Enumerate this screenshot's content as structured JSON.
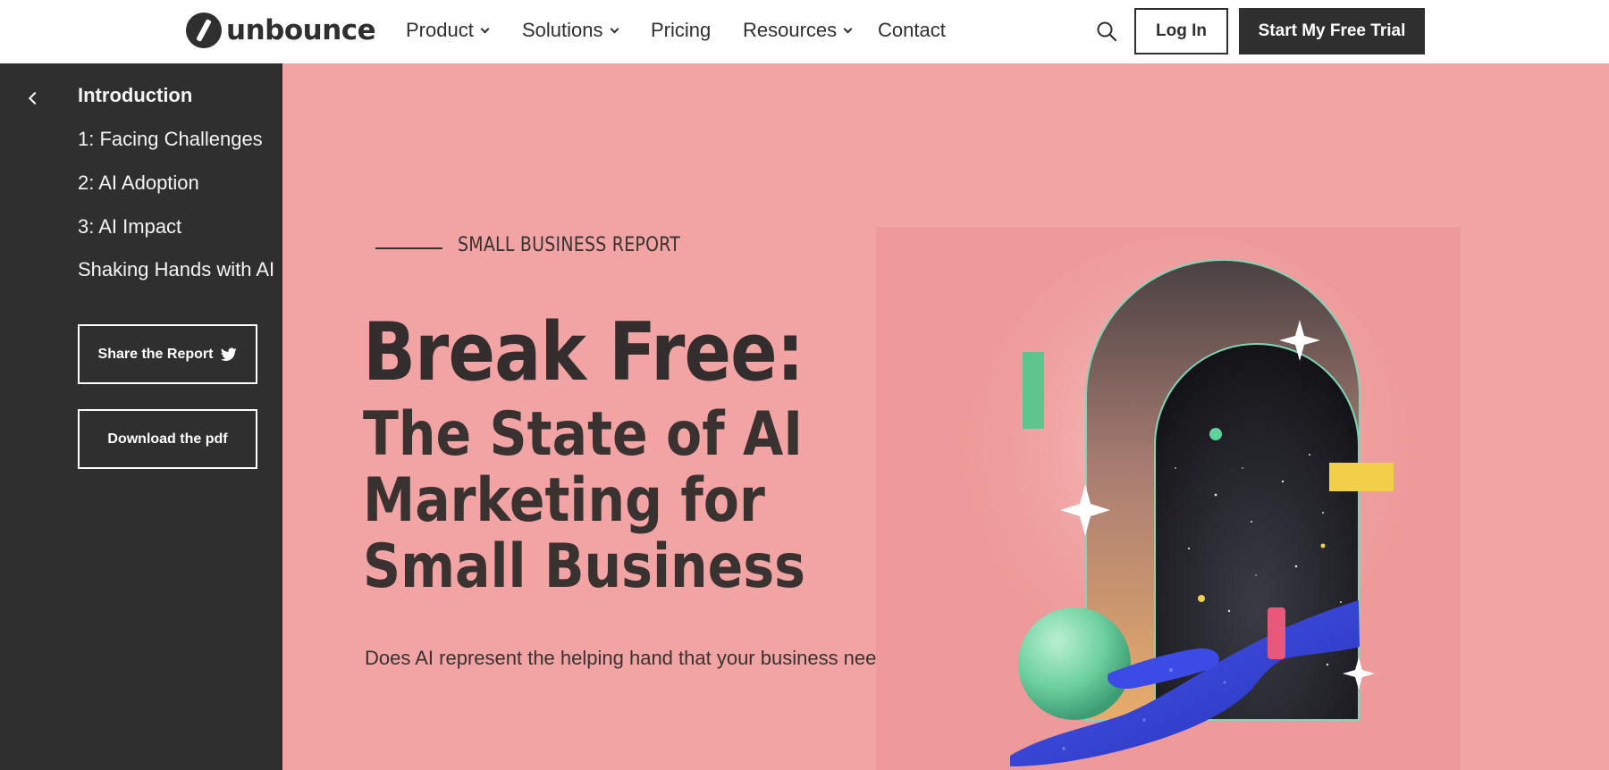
{
  "brand": {
    "name": "unbounce",
    "logo_icon": "unbounce-logo-icon"
  },
  "nav": {
    "items": [
      {
        "label": "Product",
        "dropdown": true
      },
      {
        "label": "Solutions",
        "dropdown": true
      },
      {
        "label": "Pricing",
        "dropdown": false
      },
      {
        "label": "Resources",
        "dropdown": true
      },
      {
        "label": "Contact",
        "dropdown": false
      }
    ],
    "search_icon": "search-icon",
    "login_label": "Log In",
    "trial_label": "Start My Free Trial"
  },
  "sidebar": {
    "back_icon": "chevron-left-icon",
    "items": [
      {
        "label": "Introduction",
        "active": true
      },
      {
        "label": "1: Facing Challenges"
      },
      {
        "label": "2: AI Adoption"
      },
      {
        "label": "3: AI Impact"
      },
      {
        "label": "Shaking Hands with AI"
      }
    ],
    "share_label": "Share the Report",
    "share_icon": "twitter-icon",
    "download_label": "Download the pdf"
  },
  "hero": {
    "eyebrow": "SMALL BUSINESS REPORT",
    "title": "Break Free:",
    "subtitle": "The State of AI Marketing for Small Business",
    "lede": "Does AI represent the helping hand that your business needs?"
  },
  "colors": {
    "page_bg": "#f2a3a3",
    "panel_bg": "#ee9a9a",
    "dark": "#2f2f2f",
    "accent_green": "#5ec48d",
    "accent_yellow": "#f2cf48",
    "hand_blue": "#3340d8"
  }
}
